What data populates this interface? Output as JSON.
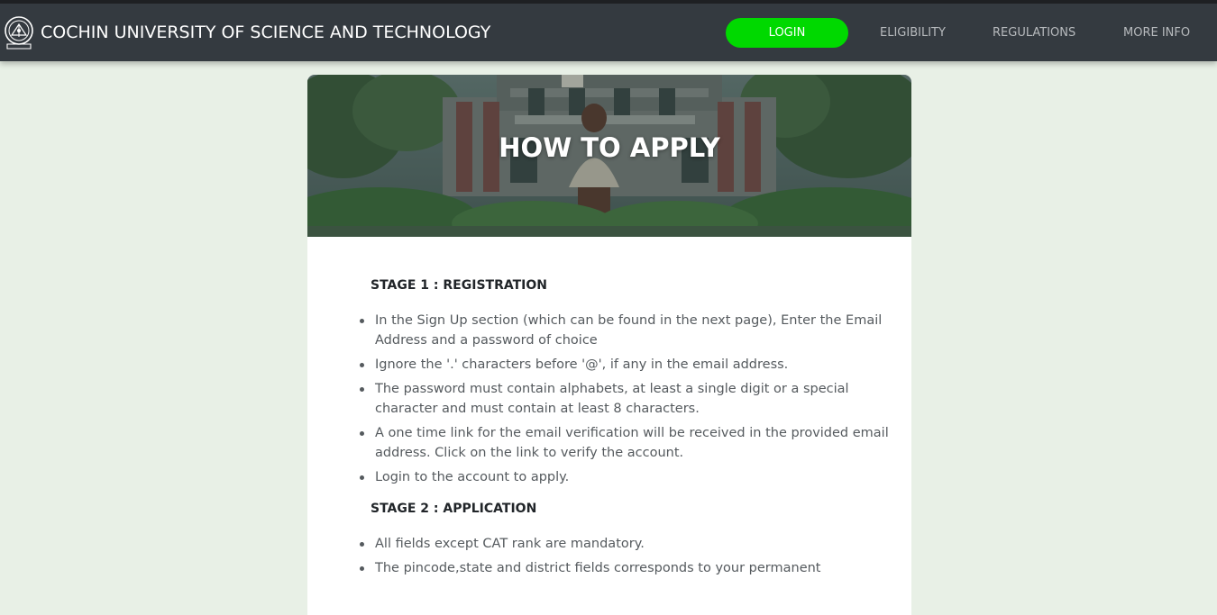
{
  "navbar": {
    "brand": "COCHIN UNIVERSITY OF SCIENCE AND TECHNOLOGY",
    "links": {
      "login": "LOGIN",
      "eligibility": "ELIGIBILITY",
      "regulations": "REGULATIONS",
      "more_info": "MORE INFO"
    },
    "login_color": "#00d900"
  },
  "hero": {
    "title": "HOW TO APPLY"
  },
  "stages": [
    {
      "title": "STAGE 1 : REGISTRATION",
      "items": [
        "In the Sign Up section (which can be found in the next page), Enter the Email Address and a password of choice",
        "Ignore the '.' characters before '@', if any in the email address.",
        "The password must contain alphabets, at least a single digit or a special character and must contain at least 8 characters.",
        "A one time link for the email verification will be received in the provided email address. Click on the link to verify the account.",
        "Login to the account to apply."
      ]
    },
    {
      "title": "STAGE 2 : APPLICATION",
      "items": [
        "All fields except CAT rank are mandatory.",
        "The pincode,state and district fields corresponds to your permanent"
      ]
    }
  ]
}
